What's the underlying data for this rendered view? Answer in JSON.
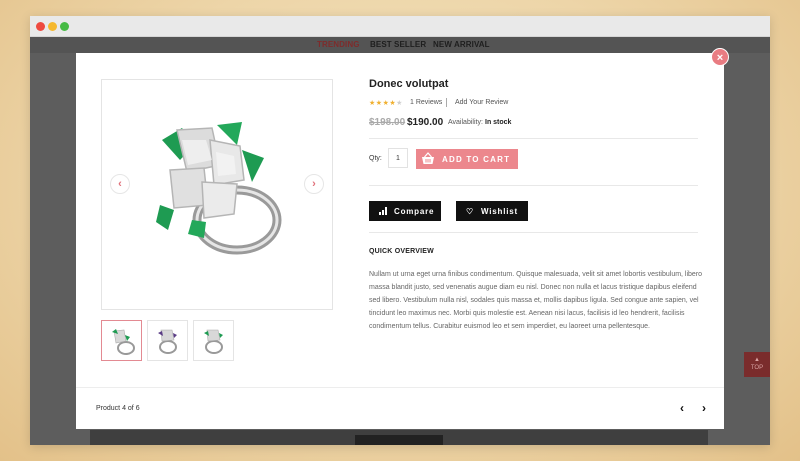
{
  "background_nav": {
    "tabs": [
      "TRENDING",
      "BEST SELLER",
      "NEW ARRIVAL"
    ],
    "to_top_label": "TOP"
  },
  "modal": {
    "close_symbol": "×",
    "product": {
      "title": "Donec volutpat",
      "rating": 4,
      "rating_max": 5,
      "reviews_label": "1 Reviews",
      "add_review_label": "Add Your Review",
      "old_price": "$198.00",
      "price": "$190.00",
      "availability_label": "Availability:",
      "availability_value": "In stock",
      "qty_label": "Qty:",
      "qty_value": "1",
      "add_to_cart_label": "ADD TO CART",
      "compare_label": "Compare",
      "wishlist_label": "Wishlist",
      "overview_title": "QUICK OVERVIEW",
      "overview_text": "Nullam ut urna eget urna finibus condimentum. Quisque malesuada, velit sit amet lobortis vestibulum, libero massa blandit justo, sed venenatis augue diam eu nisl. Donec non nulla et lacus tristique dapibus eleifend sed libero. Vestibulum nulla nisl, sodales quis massa et, mollis dapibus ligula. Sed congue ante sapien, vel tincidunt leo maximus nec. Morbi quis molestie est. Aenean nisi lacus, facilisis id leo hendrerit, facilisis condimentum tellus. Curabitur euismod leo et sem imperdiet, eu laoreet urna pellentesque."
    },
    "gallery": {
      "prev_symbol": "‹",
      "next_symbol": "›",
      "thumbnails": [
        "ring-view-1",
        "ring-view-2",
        "ring-view-3"
      ],
      "active_thumbnail": 0
    },
    "footer": {
      "product_count": "Product 4 of 6",
      "prev_symbol": "‹",
      "next_symbol": "›"
    }
  },
  "colors": {
    "accent": "#ec878d",
    "dark_button": "#111111",
    "overlay": "#5d5d5d",
    "star": "#f0b030"
  },
  "icons": {
    "close": "close-icon",
    "cart": "basket-icon",
    "compare": "bar-chart-icon",
    "wishlist": "heart-icon"
  }
}
